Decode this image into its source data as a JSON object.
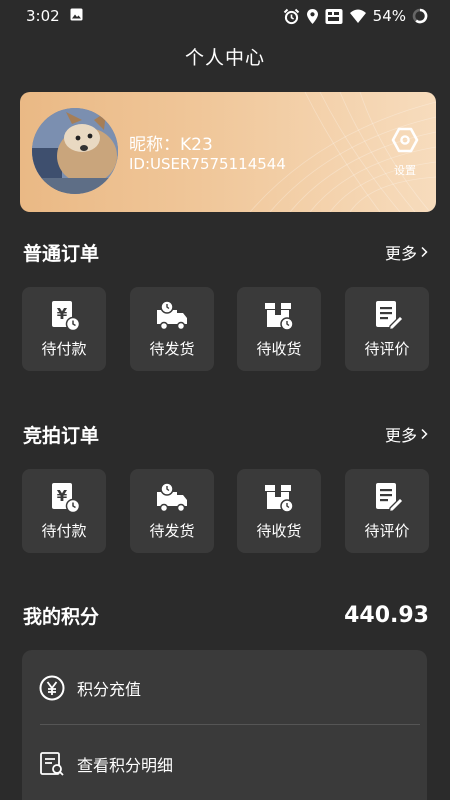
{
  "status_bar": {
    "time": "3:02",
    "battery": "54%",
    "icons": [
      "image-icon",
      "alarm-icon",
      "location-icon",
      "volte-icon",
      "wifi-icon",
      "battery-icon"
    ]
  },
  "header": {
    "title": "个人中心"
  },
  "profile": {
    "nickname": "昵称：K23",
    "user_id": "ID:USER7575114544",
    "settings_label": "设置",
    "card_gradient": [
      "#eab985",
      "#f7dcbd"
    ]
  },
  "normal_orders": {
    "title": "普通订单",
    "more": "更多",
    "items": [
      {
        "label": "待付款",
        "icon": "pending-payment-icon"
      },
      {
        "label": "待发货",
        "icon": "pending-shipment-icon"
      },
      {
        "label": "待收货",
        "icon": "pending-receipt-icon"
      },
      {
        "label": "待评价",
        "icon": "pending-review-icon"
      }
    ]
  },
  "auction_orders": {
    "title": "竞拍订单",
    "more": "更多",
    "items": [
      {
        "label": "待付款",
        "icon": "pending-payment-icon"
      },
      {
        "label": "待发货",
        "icon": "pending-shipment-icon"
      },
      {
        "label": "待收货",
        "icon": "pending-receipt-icon"
      },
      {
        "label": "待评价",
        "icon": "pending-review-icon"
      }
    ]
  },
  "points": {
    "title": "我的积分",
    "value": "440.93",
    "actions": [
      {
        "label": "积分充值",
        "icon": "yen-circle-icon"
      },
      {
        "label": "查看积分明细",
        "icon": "points-detail-icon"
      }
    ]
  },
  "colors": {
    "background": "#2b2b2b",
    "tile": "#3a3a3a",
    "divider": "#555555",
    "text": "#ffffff"
  }
}
